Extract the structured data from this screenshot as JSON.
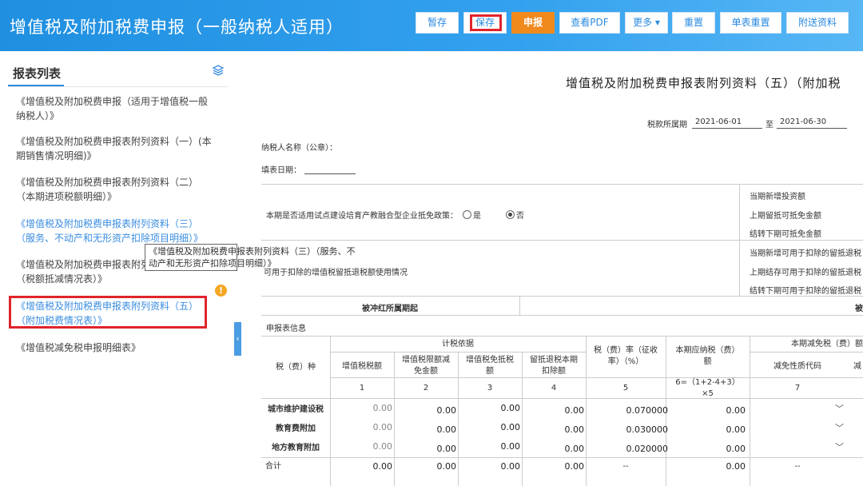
{
  "header": {
    "title": "增值税及附加税费申报（一般纳税人适用）",
    "buttons": {
      "temp_save": "暂存",
      "save": "保存",
      "submit": "申报",
      "view_pdf": "查看PDF",
      "more": "更多",
      "reset": "重置",
      "single_reset": "单表重置",
      "send_docs": "附送资料"
    }
  },
  "sidebar": {
    "title": "报表列表",
    "items": [
      {
        "line1": "《增值税及附加税费申报（适用于增值税一般",
        "line2": "纳税人）》"
      },
      {
        "line1": "《增值税及附加税费申报表附列资料（一）(本",
        "line2": "期销售情况明细)》"
      },
      {
        "line1": "《增值税及附加税费申报表附列资料（二）",
        "line2": "（本期进项税额明细）》"
      },
      {
        "line1": "《增值税及附加税费申报表附列资料（三）",
        "line2": "（服务、不动产和无形资产扣除项目明细）》"
      },
      {
        "line1": "《增值税及附加税费申报表附列资料（四）",
        "line2": "（税额抵减情况表）》"
      },
      {
        "line1": "《增值税及附加税费申报表附列资料（五）",
        "line2": "（附加税费情况表）》"
      },
      {
        "line1": "《增值税减免税申报明细表》",
        "line2": ""
      }
    ],
    "warn_badge": "!",
    "tooltip_line1": "《增值税及附加税费申报表附列资料（三）（服务、不",
    "tooltip_line2": "动产和无形资产扣除项目明细）》",
    "collapse_glyph": "‹"
  },
  "form": {
    "title": "增值税及附加税费申报表附列资料（五）（附加税",
    "period_label": "税款所属期",
    "period_start": "2021-06-01",
    "period_to": "至",
    "period_end": "2021-06-30",
    "taxpayer_label": "纳税人名称（公章）：",
    "date_label": "填表日期：",
    "pilot_question": "本期是否适用试点建设培育产教融合型企业抵免政策：",
    "option_yes": "是",
    "option_no": "否",
    "right_labels": [
      "当期新增投资额",
      "上期留抵可抵免金额",
      "结转下期可抵免金额",
      "当期新增可用于扣除的留抵退税",
      "上期结存可用于扣除的留抵退税",
      "结转下期可用于扣除的留抵退税"
    ],
    "refund_usage_label": "可用于扣除的增值税留抵退税额使用情况",
    "red_period_label": "被冲红所属期起",
    "red_period_label_right": "被",
    "section_label": "申报表信息",
    "headers": {
      "tax_type": "税（费）种",
      "basis_group": "计税依据",
      "vat_amount": "增值税税额",
      "exempt_l1": "增值税限额减",
      "exempt_l2": "免金额",
      "offset_l1": "增值税免抵税",
      "offset_l2": "额",
      "refund_l1": "留抵退税本期",
      "refund_l2": "扣除额",
      "rate_l1": "税（费）率（征收",
      "rate_l2": "率）（%）",
      "payable_l1": "本期应纳税（费）",
      "payable_l2": "额",
      "reduction_group": "本期减免税（费）额",
      "nature_code": "减免性质代码",
      "reduction_cut": "减"
    },
    "col_numbers": [
      "1",
      "2",
      "3",
      "4",
      "5",
      "6=（1+2-4+3）",
      "×5",
      "7"
    ],
    "rows": [
      {
        "name": "城市维护建设税",
        "c1": "0.00",
        "c2": "0.00",
        "c3": "0.00",
        "c4": "0.00",
        "rate": "0.070000",
        "payable": "0.00"
      },
      {
        "name": "教育费附加",
        "c1": "0.00",
        "c2": "0.00",
        "c3": "0.00",
        "c4": "0.00",
        "rate": "0.030000",
        "payable": "0.00"
      },
      {
        "name": "地方教育附加",
        "c1": "0.00",
        "c2": "0.00",
        "c3": "0.00",
        "c4": "0.00",
        "rate": "0.020000",
        "payable": "0.00"
      }
    ],
    "total": {
      "name": "合计",
      "c1": "0.00",
      "c2": "0.00",
      "c3": "0.00",
      "c4": "0.00",
      "rate": "--",
      "payable": "0.00",
      "code": "--"
    }
  }
}
